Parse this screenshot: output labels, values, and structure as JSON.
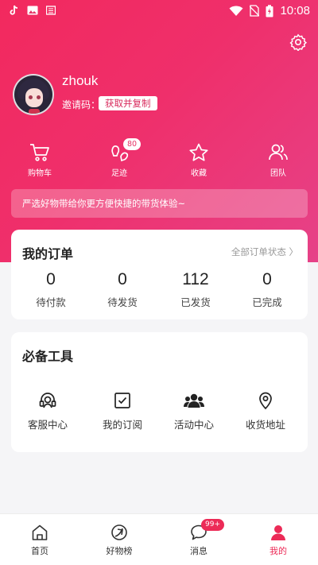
{
  "status_bar": {
    "time": "10:08"
  },
  "profile": {
    "username": "zhouk",
    "invite_label": "邀请码：",
    "invite_button": "获取并复制"
  },
  "quick_actions": [
    {
      "label": "购物车",
      "icon": "cart-icon"
    },
    {
      "label": "足迹",
      "icon": "footprint-icon",
      "badge": "80"
    },
    {
      "label": "收藏",
      "icon": "star-icon"
    },
    {
      "label": "团队",
      "icon": "team-icon"
    }
  ],
  "promo_text": "严选好物带给你更方便快捷的带货体验~",
  "orders": {
    "title": "我的订单",
    "more": "全部订单状态 〉",
    "stats": [
      {
        "value": "0",
        "label": "待付款"
      },
      {
        "value": "0",
        "label": "待发货"
      },
      {
        "value": "112",
        "label": "已发货"
      },
      {
        "value": "0",
        "label": "已完成"
      }
    ]
  },
  "tools": {
    "title": "必备工具",
    "items": [
      {
        "label": "客服中心",
        "icon": "headset-icon"
      },
      {
        "label": "我的订阅",
        "icon": "checkbox-icon"
      },
      {
        "label": "活动中心",
        "icon": "group-icon"
      },
      {
        "label": "收货地址",
        "icon": "location-pin-icon"
      }
    ]
  },
  "bottom_nav": [
    {
      "label": "首页",
      "icon": "home-icon"
    },
    {
      "label": "好物榜",
      "icon": "ranking-icon"
    },
    {
      "label": "消息",
      "icon": "message-icon",
      "badge": "99+"
    },
    {
      "label": "我的",
      "icon": "profile-icon",
      "active": true
    }
  ],
  "colors": {
    "accent": "#ec2b57",
    "header_start": "#f2295e",
    "header_end": "#e64288"
  }
}
